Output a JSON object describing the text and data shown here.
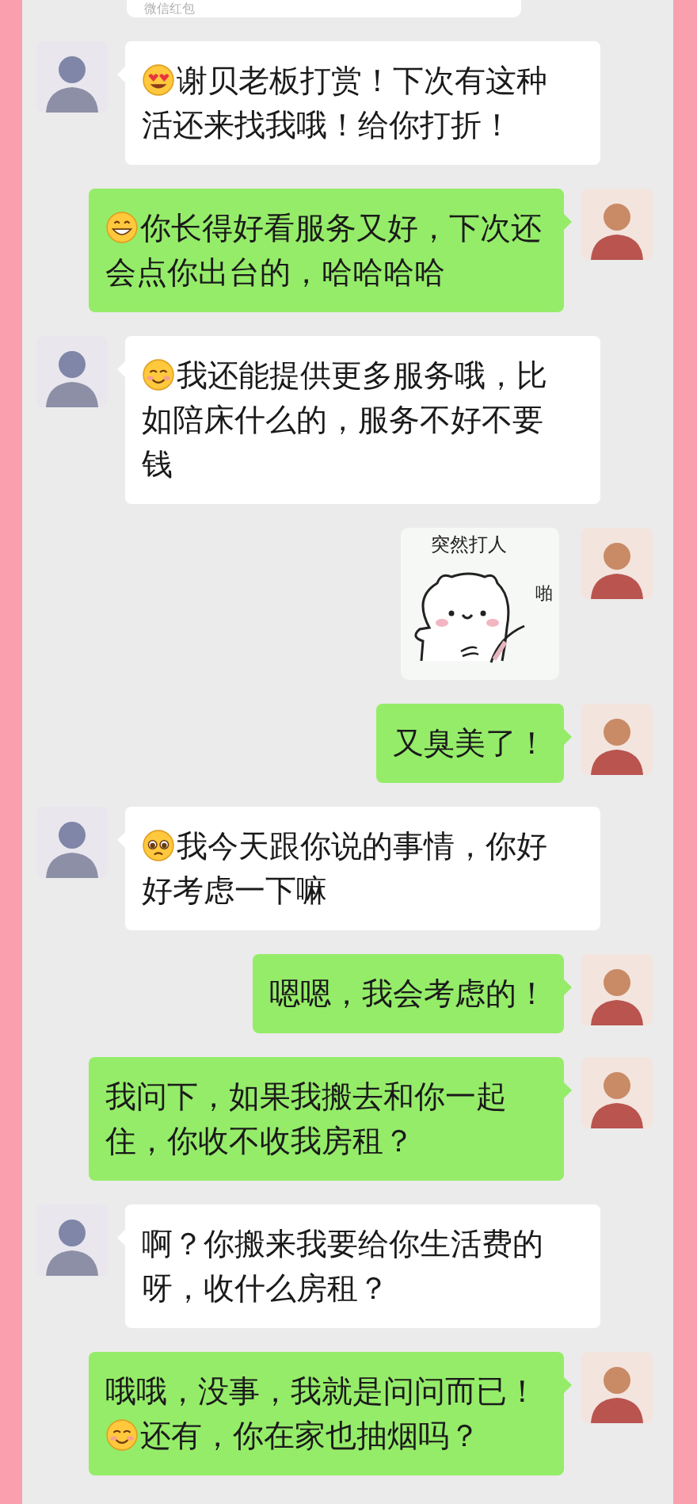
{
  "top_card": {
    "label": "微信红包"
  },
  "messages": [
    {
      "sent": false,
      "kind": "text",
      "segments": [
        {
          "kind": "emoji_hearts"
        },
        {
          "kind": "text",
          "text": "谢贝老板打赏！下次有这种活还来找我哦！给你打折！"
        }
      ]
    },
    {
      "sent": true,
      "kind": "text",
      "segments": [
        {
          "kind": "emoji_grin"
        },
        {
          "kind": "text",
          "text": "你长得好看服务又好，下次还会点你出台的，哈哈哈哈"
        }
      ]
    },
    {
      "sent": false,
      "kind": "text",
      "segments": [
        {
          "kind": "emoji_smile"
        },
        {
          "kind": "text",
          "text": "我还能提供更多服务哦，比如陪床什么的，服务不好不要钱"
        }
      ]
    },
    {
      "sent": true,
      "kind": "sticker",
      "caption": "突然打人",
      "sound": "啪"
    },
    {
      "sent": true,
      "kind": "text",
      "segments": [
        {
          "kind": "text",
          "text": "又臭美了！"
        }
      ]
    },
    {
      "sent": false,
      "kind": "text",
      "segments": [
        {
          "kind": "emoji_pleading"
        },
        {
          "kind": "text",
          "text": "我今天跟你说的事情，你好好考虑一下嘛"
        }
      ]
    },
    {
      "sent": true,
      "kind": "text",
      "segments": [
        {
          "kind": "text",
          "text": "嗯嗯，我会考虑的！"
        }
      ]
    },
    {
      "sent": true,
      "kind": "text",
      "segments": [
        {
          "kind": "text",
          "text": "我问下，如果我搬去和你一起住，你收不收我房租？"
        }
      ]
    },
    {
      "sent": false,
      "kind": "text",
      "segments": [
        {
          "kind": "text",
          "text": "啊？你搬来我要给你生活费的呀，收什么房租？"
        }
      ]
    },
    {
      "sent": true,
      "kind": "text",
      "segments": [
        {
          "kind": "text",
          "text": "哦哦，没事，我就是问问而已！"
        },
        {
          "kind": "emoji_smile"
        },
        {
          "kind": "text",
          "text": "还有，你在家也抽烟吗？"
        }
      ]
    }
  ]
}
